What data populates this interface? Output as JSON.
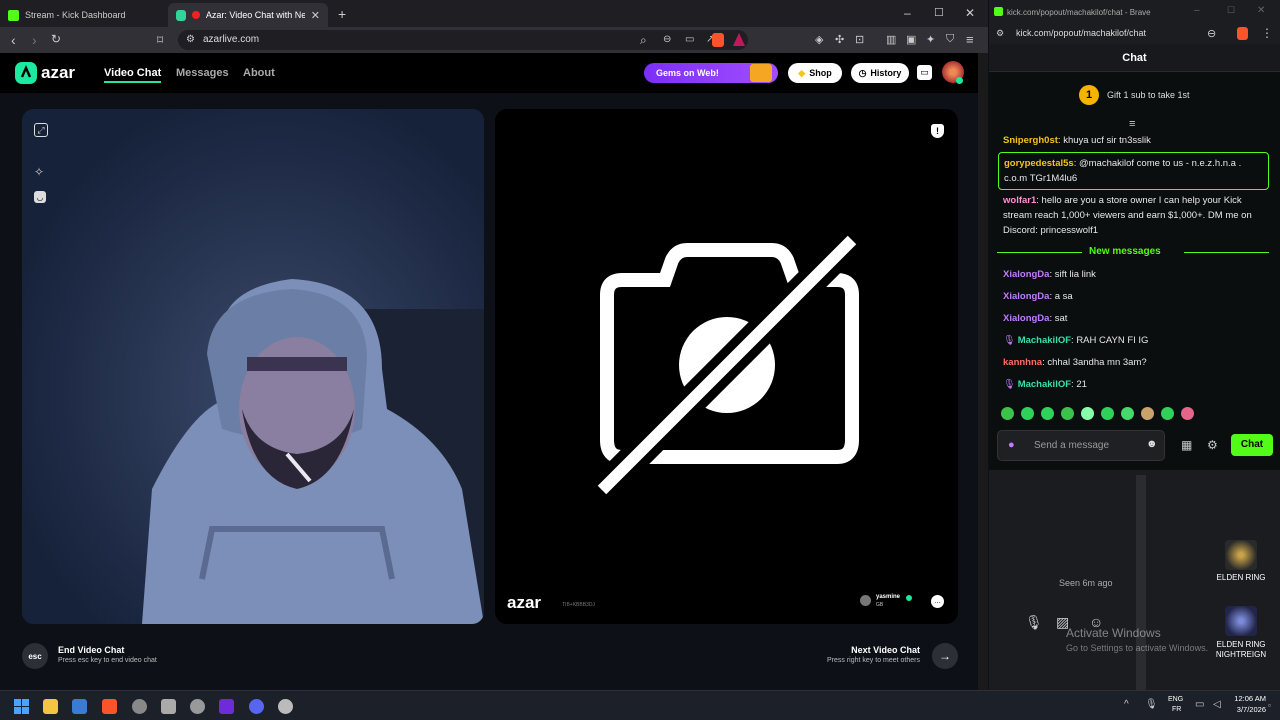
{
  "browser": {
    "tabs": [
      {
        "title": "Stream - Kick Dashboard",
        "favicon_color": "#53fc18"
      },
      {
        "title": "Azar: Video Chat with New Pe",
        "favicon_color": "#34d399"
      }
    ],
    "url": "azarlive.com"
  },
  "azar": {
    "logo": "azar",
    "nav": [
      "Video Chat",
      "Messages",
      "About"
    ],
    "gems_promo": "Gems on Web!",
    "shop_label": "Shop",
    "history_label": "History",
    "brand_watermark": "azar",
    "watermark_sub": "TIB+KBBB3DJ",
    "remote_user": "yasmine",
    "remote_country": "GB",
    "end_key": "esc",
    "end_title": "End Video Chat",
    "end_hint": "Press esc key to end video chat",
    "next_title": "Next Video Chat",
    "next_hint": "Press right key to meet others"
  },
  "kick": {
    "window_title": "kick.com/popout/machakilof/chat - Brave",
    "url": "kick.com/popout/machakilof/chat",
    "header": "Chat",
    "gift_rank": "1",
    "gift_text": "Gift 1 sub to take 1st",
    "new_messages_label": "New messages",
    "messages": [
      {
        "user": "Snipergh0st",
        "text": "khuya ucf sir tn3sslik",
        "color": "#f5c518"
      },
      {
        "user": "gorypedestal5s",
        "text": "@machakilof come to us - n.e.z.h.n.a . c.o.m TGr1M4lu6",
        "color": "#f5c518"
      },
      {
        "user": "wolfar1",
        "text": "hello are you a store owner I can help your Kick stream reach 1,000+ viewers and earn $1,000+. DM me on Discord: princesswolf1",
        "color": "#ff8fd6"
      },
      {
        "user": "XialongDa",
        "text": "sift lia link",
        "color": "#c27bff"
      },
      {
        "user": "XialongDa",
        "text": "a sa",
        "color": "#c27bff"
      },
      {
        "user": "XialongDa",
        "text": "sat",
        "color": "#c27bff"
      },
      {
        "user": "MachakilOF",
        "text": "RAH CAYN FI IG",
        "color": "#38e0a8"
      },
      {
        "user": "kannhna",
        "text": "chhal 3andha mn 3am?",
        "color": "#ff6b6b"
      },
      {
        "user": "MachakilOF",
        "text": "21",
        "color": "#38e0a8"
      }
    ],
    "input_placeholder": "Send a message",
    "chat_button": "Chat",
    "seen_text": "Seen 6m ago",
    "activate_title": "Activate Windows",
    "activate_sub": "Go to Settings to activate Windows."
  },
  "desktop": {
    "icons": [
      "ELDEN RING",
      "ELDEN RING NIGHTREIGN"
    ]
  },
  "taskbar": {
    "lang_top": "ENG",
    "lang_bottom": "FR",
    "time": "12:06 AM",
    "date": "3/7/2026"
  }
}
